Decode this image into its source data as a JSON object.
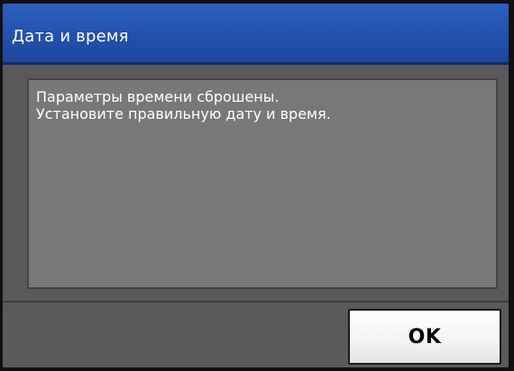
{
  "dialog": {
    "title": "Дата и время",
    "message_lines": [
      "Параметры времени сброшены.",
      "Установите правильную дату и время."
    ],
    "ok_label": "OK"
  },
  "colors": {
    "title_bar": "#2251ad",
    "body_background": "#595959",
    "message_panel": "#787878",
    "button_face": "#f3f3f3",
    "text_light": "#ffffff",
    "text_dark": "#000000"
  }
}
